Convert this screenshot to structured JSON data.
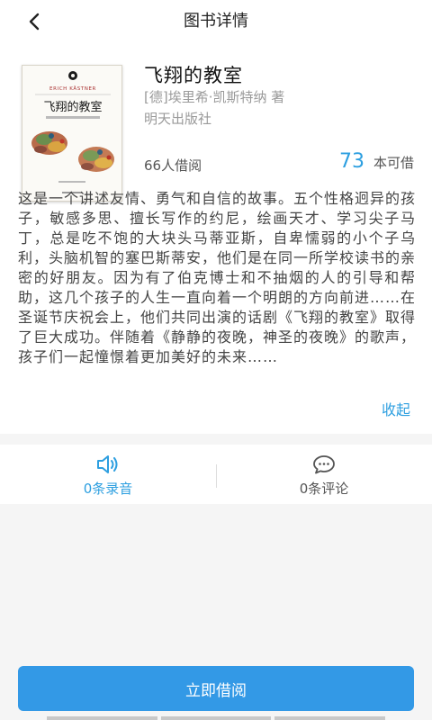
{
  "header": {
    "title": "图书详情",
    "back_icon": "chevron-left-icon"
  },
  "book": {
    "title": "飞翔的教室",
    "author": "[德]埃里希·凯斯特纳 著",
    "publisher": "明天出版社",
    "borrowed_count": "66人借阅",
    "available_number": "73",
    "available_unit": "本可借",
    "cover": {
      "title_text": "飞翔的教室",
      "latin_text": "ERICH KÄSTNER"
    },
    "description": "这是一个讲述友情、勇气和自信的故事。五个性格迥异的孩子，敏感多思、擅长写作的约尼，绘画天才、学习尖子马丁，总是吃不饱的大块头马蒂亚斯，自卑懦弱的小个子乌利，头脑机智的塞巴斯蒂安，他们是在同一所学校读书的亲密的好朋友。因为有了伯克博士和不抽烟的人的引导和帮助，这几个孩子的人生一直向着一个明朗的方向前进……在圣诞节庆祝会上，他们共同出演的话剧《飞翔的教室》取得了巨大成功。伴随着《静静的夜晚，神圣的夜晚》的歌声，孩子们一起憧憬着更加美好的未来……",
    "collapse_label": "收起"
  },
  "tabs": [
    {
      "label": "0条录音",
      "icon": "speaker-icon",
      "active": true,
      "color": "#2d9fe0"
    },
    {
      "label": "0条评论",
      "icon": "comment-icon",
      "active": false,
      "color": "#555555"
    }
  ],
  "action": {
    "borrow_label": "立即借阅",
    "accent_color": "#3399e6"
  }
}
